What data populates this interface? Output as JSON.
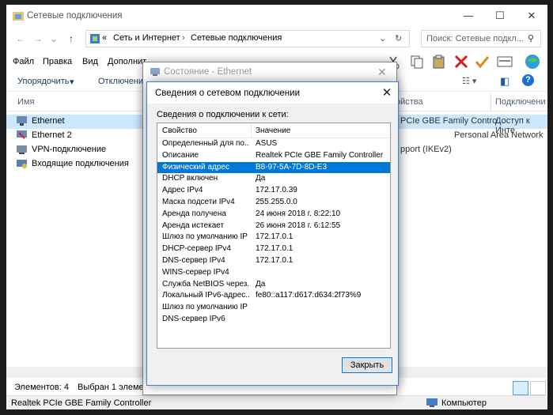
{
  "window": {
    "title": "Сетевые подключения",
    "minimize": "—",
    "maximize": "☐",
    "close": "✕"
  },
  "address": {
    "back": "←",
    "forward": "→",
    "recent": "⌄",
    "up": "↑",
    "chevrons": "«",
    "crumb1": "Сеть и Интернет",
    "sep": "›",
    "crumb2": "Сетевые подключения",
    "dropdown": "⌄",
    "refresh": "↻",
    "search_placeholder": "Поиск: Сетевые подкл...",
    "search_icon": "⚲"
  },
  "menu": {
    "file": "Файл",
    "edit": "Правка",
    "view": "Вид",
    "more": "Дополнит"
  },
  "toolbar": {
    "organize": "Упорядочить",
    "organize_arrow": "▾",
    "disable": "Отключени",
    "view_glyph": "☷ ▾",
    "pane_glyph": "◧",
    "help_glyph": "?"
  },
  "columns": {
    "name": "Имя",
    "device": "ойства",
    "connectivity": "Подключени"
  },
  "connections": [
    {
      "name": "Ethernet",
      "device": "PCIe GBE Family Contro...",
      "connectivity": "Доступ к Инте",
      "selected": true
    },
    {
      "name": "Ethernet 2",
      "device": "Personal Area Network",
      "connectivity": "",
      "selected": false
    },
    {
      "name": "VPN-подключение",
      "device": "pport (IKEv2)",
      "connectivity": "",
      "selected": false
    },
    {
      "name": "Входящие подключения",
      "device": "",
      "connectivity": "",
      "selected": false
    }
  ],
  "status": {
    "items": "Элементов: 4",
    "selected": "Выбран 1 элемент",
    "device": "Realtek PCIe GBE Family Controller",
    "computer": "Компьютер"
  },
  "status_dialog": {
    "title": "Состояние - Ethernet",
    "close": "✕"
  },
  "details_dialog": {
    "title": "Сведения о сетевом подключении",
    "close": "✕",
    "caption": "Сведения о подключении к сети:",
    "col_property": "Свойство",
    "col_value": "Значение",
    "rows": [
      {
        "p": "Определенный для по...",
        "v": "ASUS",
        "selected": false
      },
      {
        "p": "Описание",
        "v": "Realtek PCIe GBE Family Controller",
        "selected": false
      },
      {
        "p": "Физический адрес",
        "v": "B8-97-5A-7D-8D-E3",
        "selected": true
      },
      {
        "p": "DHCP включен",
        "v": "Да",
        "selected": false
      },
      {
        "p": "Адрес IPv4",
        "v": "172.17.0.39",
        "selected": false
      },
      {
        "p": "Маска подсети IPv4",
        "v": "255.255.0.0",
        "selected": false
      },
      {
        "p": "Аренда получена",
        "v": "24 июня 2018 г. 8:22:10",
        "selected": false
      },
      {
        "p": "Аренда истекает",
        "v": "26 июня 2018 г. 6:12:55",
        "selected": false
      },
      {
        "p": "Шлюз по умолчанию IP",
        "v": "172.17.0.1",
        "selected": false
      },
      {
        "p": "DHCP-сервер IPv4",
        "v": "172.17.0.1",
        "selected": false
      },
      {
        "p": "DNS-сервер IPv4",
        "v": "172.17.0.1",
        "selected": false
      },
      {
        "p": "WINS-сервер IPv4",
        "v": "",
        "selected": false
      },
      {
        "p": "Служба NetBIOS через...",
        "v": "Да",
        "selected": false
      },
      {
        "p": "Локальный IPv6-адрес...",
        "v": "fe80::a117:d617:d634:2f73%9",
        "selected": false
      },
      {
        "p": "Шлюз по умолчанию IP",
        "v": "",
        "selected": false
      },
      {
        "p": "DNS-сервер IPv6",
        "v": "",
        "selected": false
      }
    ],
    "close_button": "Закрыть"
  },
  "colors": {
    "accent": "#0078d7",
    "selection": "#cce8ff"
  }
}
